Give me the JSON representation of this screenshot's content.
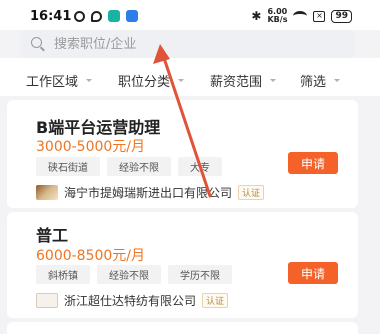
{
  "status_bar": {
    "time": "16:41",
    "speed_value": "6.00",
    "speed_unit": "KB/s",
    "battery": "99"
  },
  "search": {
    "placeholder": "搜索职位/企业"
  },
  "filters": [
    {
      "label": "工作区域"
    },
    {
      "label": "职位分类"
    },
    {
      "label": "薪资范围"
    },
    {
      "label": "筛选"
    }
  ],
  "jobs": [
    {
      "title": "B端平台运营助理",
      "salary": "3000-5000元/月",
      "tags": [
        "硖石街道",
        "经验不限",
        "大专"
      ],
      "apply_label": "申请",
      "company": "海宁市提姆瑞斯进出口有限公司",
      "verified": "认证"
    },
    {
      "title": "普工",
      "salary": "6000-8500元/月",
      "tags": [
        "斜桥镇",
        "经验不限",
        "学历不限"
      ],
      "apply_label": "申请",
      "company": "浙江超仕达特纺有限公司",
      "verified": "认证"
    }
  ],
  "colors": {
    "accent": "#f4622a",
    "salary": "#ee7523",
    "annotation_arrow": "#e0533a"
  }
}
